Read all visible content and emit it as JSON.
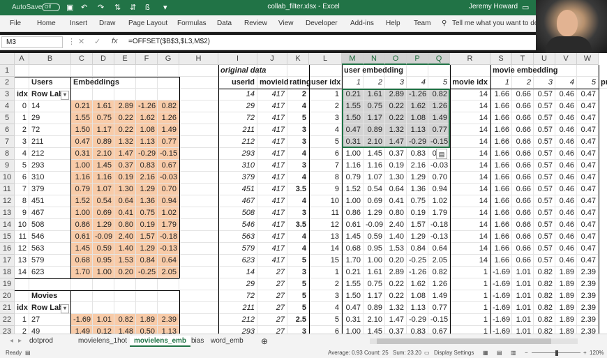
{
  "titlebar": {
    "autosave_label": "AutoSave",
    "autosave_state": "Off",
    "filename": "collab_filter.xlsx - Excel",
    "user": "Jeremy Howard"
  },
  "menu": [
    "File",
    "Home",
    "Insert",
    "Draw",
    "Page Layout",
    "Formulas",
    "Data",
    "Review",
    "View",
    "Developer",
    "Add-ins",
    "Help",
    "Team"
  ],
  "tellme": "Tell me what you want to do",
  "namebox": "M3",
  "formula": "=OFFSET($B$3,$L3,M$2)",
  "columns": [
    "A",
    "B",
    "C",
    "D",
    "E",
    "F",
    "G",
    "H",
    "I",
    "J",
    "K",
    "L",
    "M",
    "N",
    "O",
    "P",
    "Q",
    "R",
    "S",
    "T",
    "U",
    "V",
    "W"
  ],
  "selected_columns": [
    "M",
    "N",
    "O",
    "P",
    "Q"
  ],
  "rows": [
    1,
    2,
    3,
    4,
    5,
    6,
    7,
    8,
    9,
    10,
    11,
    12,
    13,
    14,
    15,
    16,
    17,
    18,
    19,
    20,
    21,
    22,
    23
  ],
  "headers": {
    "users": "Users",
    "embeddings": "Embeddings",
    "original_data": "original data",
    "user_embedding": "user embedding",
    "movie_embedding": "movie embedding",
    "userId": "userId",
    "movieId": "movieId",
    "rating": "rating",
    "user_idx": "user idx",
    "movie_idx": "movie idx",
    "idx": "idx",
    "row_labels": "Row Lab",
    "movies": "Movies",
    "pr": "pr",
    "dims": [
      "1",
      "2",
      "3",
      "4",
      "5"
    ]
  },
  "users_table": [
    {
      "idx": "0",
      "id": "14",
      "e": [
        "0.21",
        "1.61",
        "2.89",
        "-1.26",
        "0.82"
      ]
    },
    {
      "idx": "1",
      "id": "29",
      "e": [
        "1.55",
        "0.75",
        "0.22",
        "1.62",
        "1.26"
      ]
    },
    {
      "idx": "2",
      "id": "72",
      "e": [
        "1.50",
        "1.17",
        "0.22",
        "1.08",
        "1.49"
      ]
    },
    {
      "idx": "3",
      "id": "211",
      "e": [
        "0.47",
        "0.89",
        "1.32",
        "1.13",
        "0.77"
      ]
    },
    {
      "idx": "4",
      "id": "212",
      "e": [
        "0.31",
        "2.10",
        "1.47",
        "-0.29",
        "-0.15"
      ]
    },
    {
      "idx": "5",
      "id": "293",
      "e": [
        "1.00",
        "1.45",
        "0.37",
        "0.83",
        "0.67"
      ]
    },
    {
      "idx": "6",
      "id": "310",
      "e": [
        "1.16",
        "1.16",
        "0.19",
        "2.16",
        "-0.03"
      ]
    },
    {
      "idx": "7",
      "id": "379",
      "e": [
        "0.79",
        "1.07",
        "1.30",
        "1.29",
        "0.70"
      ]
    },
    {
      "idx": "8",
      "id": "451",
      "e": [
        "1.52",
        "0.54",
        "0.64",
        "1.36",
        "0.94"
      ]
    },
    {
      "idx": "9",
      "id": "467",
      "e": [
        "1.00",
        "0.69",
        "0.41",
        "0.75",
        "1.02"
      ]
    },
    {
      "idx": "10",
      "id": "508",
      "e": [
        "0.86",
        "1.29",
        "0.80",
        "0.19",
        "1.79"
      ]
    },
    {
      "idx": "11",
      "id": "546",
      "e": [
        "0.61",
        "-0.09",
        "2.40",
        "1.57",
        "-0.18"
      ]
    },
    {
      "idx": "12",
      "id": "563",
      "e": [
        "1.45",
        "0.59",
        "1.40",
        "1.29",
        "-0.13"
      ]
    },
    {
      "idx": "13",
      "id": "579",
      "e": [
        "0.68",
        "0.95",
        "1.53",
        "0.84",
        "0.64"
      ]
    },
    {
      "idx": "14",
      "id": "623",
      "e": [
        "1.70",
        "1.00",
        "0.20",
        "-0.25",
        "2.05"
      ]
    }
  ],
  "movies_table": [
    {
      "idx": "1",
      "id": "27",
      "e": [
        "-1.69",
        "1.01",
        "0.82",
        "1.89",
        "2.39"
      ]
    },
    {
      "idx": "2",
      "id": "49",
      "e": [
        "1.49",
        "0.12",
        "1.48",
        "0.50",
        "1.13"
      ]
    }
  ],
  "data_rows": [
    {
      "userId": "14",
      "movieId": "417",
      "rating": "2",
      "uidx": "1",
      "ue": [
        "0.21",
        "1.61",
        "2.89",
        "-1.26",
        "0.82"
      ],
      "midx": "14",
      "me": [
        "1.66",
        "0.66",
        "0.57",
        "0.46",
        "0.47"
      ]
    },
    {
      "userId": "29",
      "movieId": "417",
      "rating": "4",
      "uidx": "2",
      "ue": [
        "1.55",
        "0.75",
        "0.22",
        "1.62",
        "1.26"
      ],
      "midx": "14",
      "me": [
        "1.66",
        "0.66",
        "0.57",
        "0.46",
        "0.47"
      ]
    },
    {
      "userId": "72",
      "movieId": "417",
      "rating": "5",
      "uidx": "3",
      "ue": [
        "1.50",
        "1.17",
        "0.22",
        "1.08",
        "1.49"
      ],
      "midx": "14",
      "me": [
        "1.66",
        "0.66",
        "0.57",
        "0.46",
        "0.47"
      ]
    },
    {
      "userId": "211",
      "movieId": "417",
      "rating": "3",
      "uidx": "4",
      "ue": [
        "0.47",
        "0.89",
        "1.32",
        "1.13",
        "0.77"
      ],
      "midx": "14",
      "me": [
        "1.66",
        "0.66",
        "0.57",
        "0.46",
        "0.47"
      ]
    },
    {
      "userId": "212",
      "movieId": "417",
      "rating": "3",
      "uidx": "5",
      "ue": [
        "0.31",
        "2.10",
        "1.47",
        "-0.29",
        "-0.15"
      ],
      "midx": "14",
      "me": [
        "1.66",
        "0.66",
        "0.57",
        "0.46",
        "0.47"
      ]
    },
    {
      "userId": "293",
      "movieId": "417",
      "rating": "4",
      "uidx": "6",
      "ue": [
        "1.00",
        "1.45",
        "0.37",
        "0.83",
        "0.67"
      ],
      "midx": "14",
      "me": [
        "1.66",
        "0.66",
        "0.57",
        "0.46",
        "0.47"
      ]
    },
    {
      "userId": "310",
      "movieId": "417",
      "rating": "3",
      "uidx": "7",
      "ue": [
        "1.16",
        "1.16",
        "0.19",
        "2.16",
        "-0.03"
      ],
      "midx": "14",
      "me": [
        "1.66",
        "0.66",
        "0.57",
        "0.46",
        "0.47"
      ]
    },
    {
      "userId": "379",
      "movieId": "417",
      "rating": "4",
      "uidx": "8",
      "ue": [
        "0.79",
        "1.07",
        "1.30",
        "1.29",
        "0.70"
      ],
      "midx": "14",
      "me": [
        "1.66",
        "0.66",
        "0.57",
        "0.46",
        "0.47"
      ]
    },
    {
      "userId": "451",
      "movieId": "417",
      "rating": "3.5",
      "uidx": "9",
      "ue": [
        "1.52",
        "0.54",
        "0.64",
        "1.36",
        "0.94"
      ],
      "midx": "14",
      "me": [
        "1.66",
        "0.66",
        "0.57",
        "0.46",
        "0.47"
      ]
    },
    {
      "userId": "467",
      "movieId": "417",
      "rating": "4",
      "uidx": "10",
      "ue": [
        "1.00",
        "0.69",
        "0.41",
        "0.75",
        "1.02"
      ],
      "midx": "14",
      "me": [
        "1.66",
        "0.66",
        "0.57",
        "0.46",
        "0.47"
      ]
    },
    {
      "userId": "508",
      "movieId": "417",
      "rating": "3",
      "uidx": "11",
      "ue": [
        "0.86",
        "1.29",
        "0.80",
        "0.19",
        "1.79"
      ],
      "midx": "14",
      "me": [
        "1.66",
        "0.66",
        "0.57",
        "0.46",
        "0.47"
      ]
    },
    {
      "userId": "546",
      "movieId": "417",
      "rating": "3.5",
      "uidx": "12",
      "ue": [
        "0.61",
        "-0.09",
        "2.40",
        "1.57",
        "-0.18"
      ],
      "midx": "14",
      "me": [
        "1.66",
        "0.66",
        "0.57",
        "0.46",
        "0.47"
      ]
    },
    {
      "userId": "563",
      "movieId": "417",
      "rating": "4",
      "uidx": "13",
      "ue": [
        "1.45",
        "0.59",
        "1.40",
        "1.29",
        "-0.13"
      ],
      "midx": "14",
      "me": [
        "1.66",
        "0.66",
        "0.57",
        "0.46",
        "0.47"
      ]
    },
    {
      "userId": "579",
      "movieId": "417",
      "rating": "4",
      "uidx": "14",
      "ue": [
        "0.68",
        "0.95",
        "1.53",
        "0.84",
        "0.64"
      ],
      "midx": "14",
      "me": [
        "1.66",
        "0.66",
        "0.57",
        "0.46",
        "0.47"
      ]
    },
    {
      "userId": "623",
      "movieId": "417",
      "rating": "5",
      "uidx": "15",
      "ue": [
        "1.70",
        "1.00",
        "0.20",
        "-0.25",
        "2.05"
      ],
      "midx": "14",
      "me": [
        "1.66",
        "0.66",
        "0.57",
        "0.46",
        "0.47"
      ]
    },
    {
      "userId": "14",
      "movieId": "27",
      "rating": "3",
      "uidx": "1",
      "ue": [
        "0.21",
        "1.61",
        "2.89",
        "-1.26",
        "0.82"
      ],
      "midx": "1",
      "me": [
        "-1.69",
        "1.01",
        "0.82",
        "1.89",
        "2.39"
      ]
    },
    {
      "userId": "29",
      "movieId": "27",
      "rating": "5",
      "uidx": "2",
      "ue": [
        "1.55",
        "0.75",
        "0.22",
        "1.62",
        "1.26"
      ],
      "midx": "1",
      "me": [
        "-1.69",
        "1.01",
        "0.82",
        "1.89",
        "2.39"
      ]
    },
    {
      "userId": "72",
      "movieId": "27",
      "rating": "5",
      "uidx": "3",
      "ue": [
        "1.50",
        "1.17",
        "0.22",
        "1.08",
        "1.49"
      ],
      "midx": "1",
      "me": [
        "-1.69",
        "1.01",
        "0.82",
        "1.89",
        "2.39"
      ]
    },
    {
      "userId": "211",
      "movieId": "27",
      "rating": "5",
      "uidx": "4",
      "ue": [
        "0.47",
        "0.89",
        "1.32",
        "1.13",
        "0.77"
      ],
      "midx": "1",
      "me": [
        "-1.69",
        "1.01",
        "0.82",
        "1.89",
        "2.39"
      ]
    },
    {
      "userId": "212",
      "movieId": "27",
      "rating": "2.5",
      "uidx": "5",
      "ue": [
        "0.31",
        "2.10",
        "1.47",
        "-0.29",
        "-0.15"
      ],
      "midx": "1",
      "me": [
        "-1.69",
        "1.01",
        "0.82",
        "1.89",
        "2.39"
      ]
    },
    {
      "userId": "293",
      "movieId": "27",
      "rating": "3",
      "uidx": "6",
      "ue": [
        "1.00",
        "1.45",
        "0.37",
        "0.83",
        "0.67"
      ],
      "midx": "1",
      "me": [
        "-1.69",
        "1.01",
        "0.82",
        "1.89",
        "2.39"
      ]
    }
  ],
  "sheet_tabs": [
    "dotprod",
    "movielens_1hot",
    "movielens_emb",
    "bias",
    "word_emb"
  ],
  "active_tab": "movielens_emb",
  "status": {
    "ready": "Ready",
    "average": "Average: 0.93",
    "count": "Count: 25",
    "sum": "Sum: 23.20",
    "display_settings": "Display Settings",
    "zoom": "120%"
  },
  "colors": {
    "excel_green": "#217346",
    "embedding_orange": "#f8cba8",
    "selection_gray": "#d3d3d3"
  },
  "icons": [
    "save-icon",
    "undo-icon",
    "redo-icon",
    "sort-icon",
    "ribbon-toggle-icon",
    "search-icon",
    "cancel-icon",
    "enter-icon",
    "function-icon",
    "add-sheet-icon",
    "paste-options-icon"
  ]
}
